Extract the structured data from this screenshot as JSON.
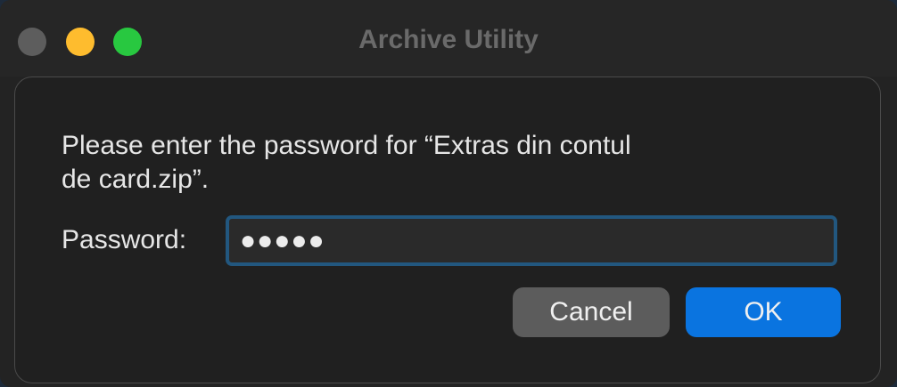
{
  "window": {
    "title": "Archive Utility",
    "traffic_lights": {
      "close_color": "#5d5d5d",
      "minimize_color": "#febc2e",
      "maximize_color": "#28c840"
    }
  },
  "dialog": {
    "message_line1": "Please enter the password for “Extras din contul",
    "message_line2": "de card.zip”.",
    "password_label": "Password:",
    "password_masked": "●●●●●",
    "cancel_label": "Cancel",
    "ok_label": "OK"
  },
  "colors": {
    "accent": "#0a74e0",
    "focus_ring": "#22577f"
  }
}
